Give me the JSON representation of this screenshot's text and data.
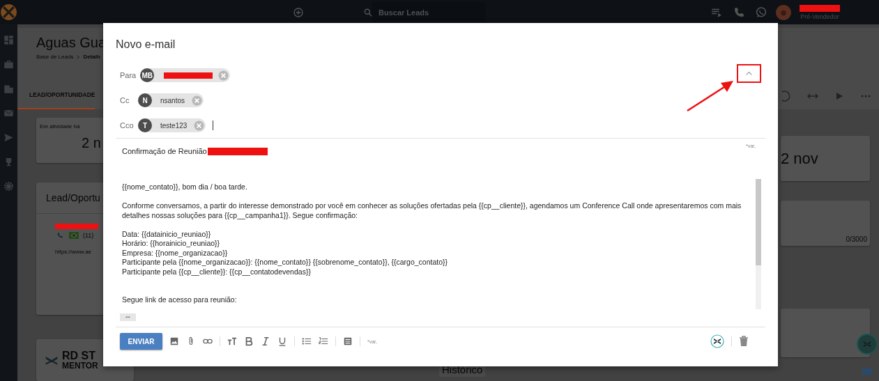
{
  "top_bar": {
    "search": {
      "placeholder": "Buscar Leads"
    },
    "user_role": "Pré-Vendedor"
  },
  "page": {
    "title": "Aguas Gua",
    "breadcrumb": [
      "Base de Leads",
      "Detalh"
    ],
    "tabs": [
      {
        "label": "LEAD/OPORTUNIDADE",
        "selected": true
      }
    ],
    "activity_card": {
      "label": "Em atividade há",
      "value": "2 n"
    },
    "lead_card": {
      "title": "Lead/Oportu",
      "phone": "(11)",
      "website": "https://www.ae"
    },
    "logo_card": {
      "line_1": "RD ST",
      "line_2": "MENTOR"
    },
    "date_card": {
      "value": "2 nov"
    },
    "notes_card": {
      "counter": "0/3000"
    },
    "history_title": "Histórico"
  },
  "email_dialog": {
    "title": "Novo e-mail",
    "recipients_expanded": true,
    "recipients": [
      {
        "label": "Para",
        "focused": false,
        "chips": [
          {
            "initials": "MB",
            "redacted": true
          }
        ]
      },
      {
        "label": "Cc",
        "focused": false,
        "chips": [
          {
            "initials": "N",
            "name": "nsantos",
            "redacted": false
          }
        ]
      },
      {
        "label": "Cco",
        "focused": true,
        "chips": [
          {
            "initials": "T",
            "name": "teste123",
            "redacted": false
          }
        ]
      }
    ],
    "subject": {
      "text": "Confirmação de Reunião",
      "redacted": true,
      "variables_hint": "*var,"
    },
    "body": [
      [
        "{{nome_contato}}, bom dia / boa tarde."
      ],
      [
        "Conforme conversamos, a partir do interesse demonstrado por você em conhecer as soluções ofertadas pela {{cp__cliente}}, agendamos um Conference Call onde apresentaremos com mais detalhes nossas soluções para {{cp__campanha1}}. Segue confirmação:"
      ],
      [
        "Data: {{datainicio_reuniao}}",
        "Horário: {{horainicio_reuniao}}",
        "Empresa: {{nome_organizacao}}",
        "Participante pela {{nome_organizacao}}: {{nome_contato}} {{sobrenome_contato}}, {{cargo_contato}}",
        "Participante pela {{cp__cliente}}: {{cp__contatodevendas}}"
      ],
      [
        "Segue link de acesso para reunião:"
      ]
    ],
    "more_label": "•••",
    "toolbar": {
      "send_label": "ENVIAR",
      "variables_hint": "*var,"
    }
  }
}
